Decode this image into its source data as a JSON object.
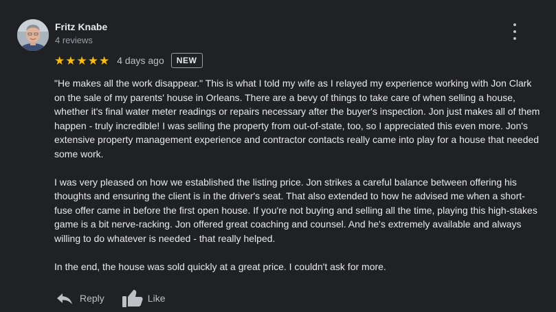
{
  "author": {
    "name": "Fritz Knabe",
    "reviews_count": "4 reviews"
  },
  "rating": {
    "stars": 5,
    "star_glyphs": [
      "★",
      "★",
      "★",
      "★",
      "★"
    ],
    "star_color": "#fbbc04"
  },
  "date": "4 days ago",
  "badge": "NEW",
  "body": {
    "paragraphs": [
      "\"He makes all the work disappear.\" This is what I told my wife as I relayed my experience working with Jon Clark on the sale of my parents' house in Orleans. There are a bevy of things to take care of when selling a house, whether it's final water meter readings or repairs necessary after the buyer's inspection. Jon just makes all of them happen - truly incredible! I was selling the property from out-of-state, too, so I appreciated this even more. Jon's extensive property management experience and contractor contacts really came into play for a house that needed some work.",
      "I was very pleased on how we established the listing price. Jon strikes a careful balance between offering his thoughts and ensuring the client is in the driver's seat. That also extended to how he advised me when a short-fuse offer came in before the first open house. If you're not buying and selling all the time, playing this high-stakes game is a bit nerve-racking. Jon offered great coaching and counsel. And he's extremely available and always willing to do whatever is needed - that really helped.",
      "In the end, the house was sold quickly at a great price. I couldn't ask for more."
    ]
  },
  "actions": {
    "reply_label": "Reply",
    "like_label": "Like"
  },
  "icons": {
    "more": "more-vert-icon",
    "reply": "reply-arrow-icon",
    "like": "thumbs-up-icon"
  },
  "colors": {
    "background": "#202124",
    "text": "#e8eaed",
    "secondary_text": "#9aa0a6"
  }
}
